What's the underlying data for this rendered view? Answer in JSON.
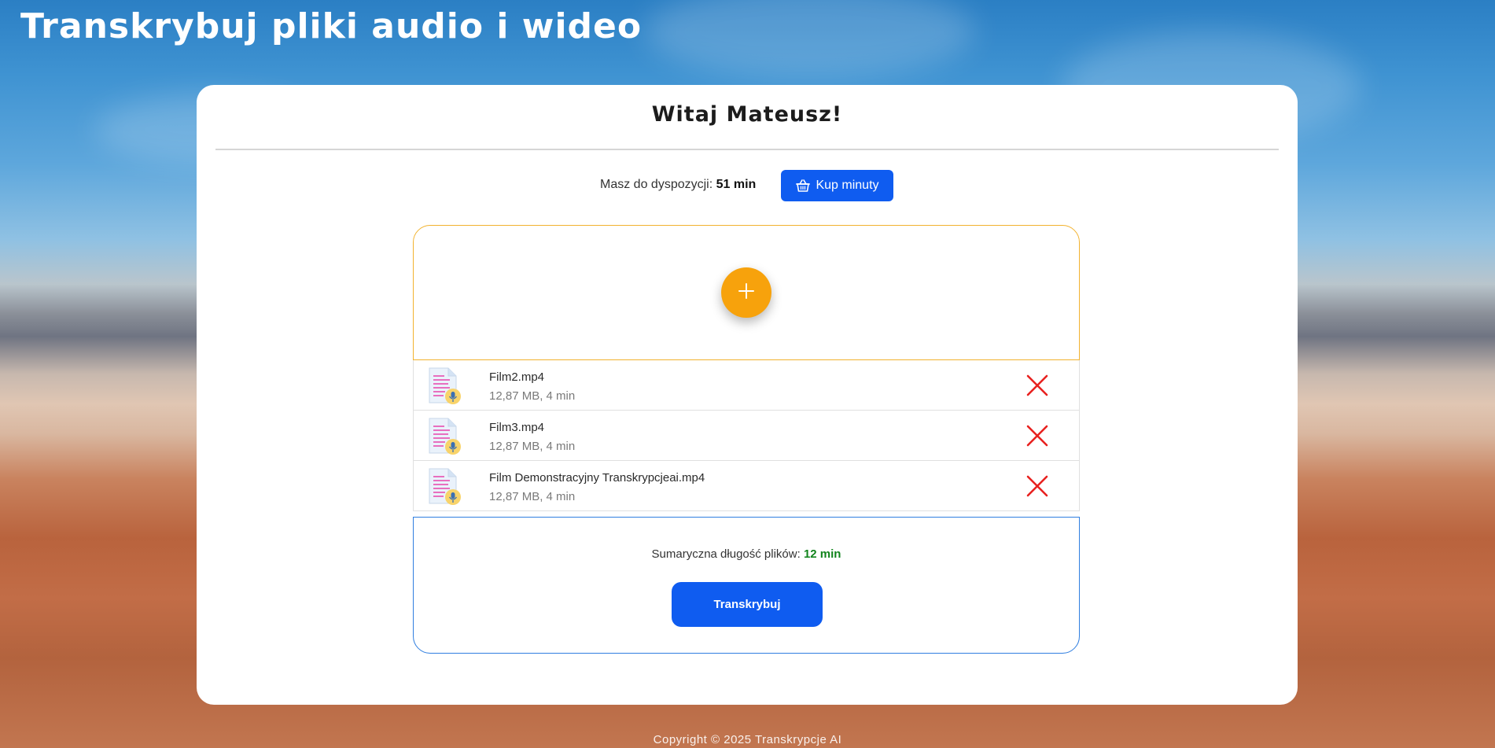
{
  "header": {
    "title": "Transkrybuj pliki audio i wideo"
  },
  "card": {
    "greeting": "Witaj Mateusz!",
    "minutes_label": "Masz do dyspozycji:",
    "minutes_value": "51 min",
    "buy_button_label": "Kup minuty"
  },
  "upload": {
    "add_icon": "plus-icon"
  },
  "files": [
    {
      "name": "Film2.mp4",
      "meta": "12,87 MB, 4 min"
    },
    {
      "name": "Film3.mp4",
      "meta": "12,87 MB, 4 min"
    },
    {
      "name": "Film Demonstracyjny Transkrypcjeai.mp4",
      "meta": "12,87 MB, 4 min"
    }
  ],
  "summary": {
    "label": "Sumaryczna długość plików:",
    "value": "12 min",
    "transcribe_button_label": "Transkrybuj"
  },
  "footer": {
    "copyright": "Copyright © 2025 Transkrypcje AI"
  },
  "colors": {
    "primary_button": "#0f5cf0",
    "accent_orange": "#f7a20c",
    "remove_red": "#e8211f",
    "summary_green": "#11841c"
  }
}
